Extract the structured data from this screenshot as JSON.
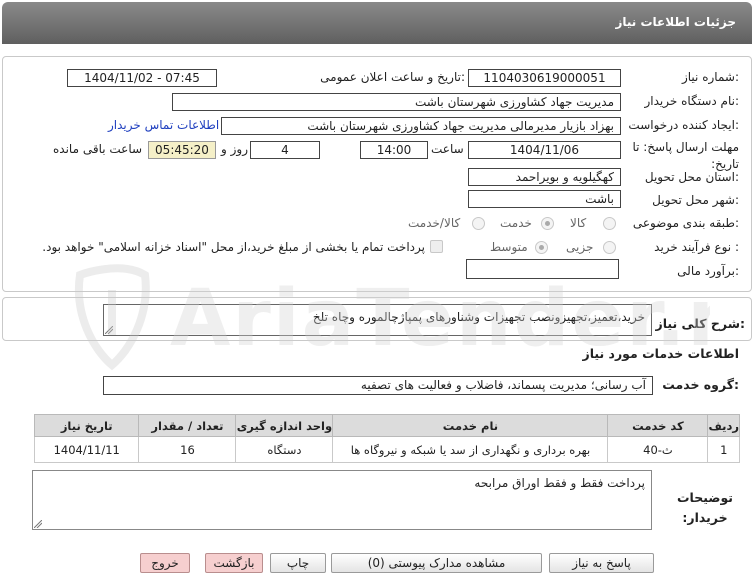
{
  "header": {
    "title": "جزئیات اطلاعات نیاز"
  },
  "form": {
    "need_number_label": "شماره نیاز:",
    "need_number": "1104030619000051",
    "announce_label": "تاریخ و ساعت اعلان عمومی:",
    "announce_value": "1404/11/02 - 07:45",
    "buyer_org_label": "نام دستگاه خریدار:",
    "buyer_org": "مدیریت جهاد کشاورزی شهرستان باشت",
    "creator_label": "ایجاد کننده درخواست:",
    "creator": "بهزاد بازیار مدیرمالی مدیریت جهاد کشاورزی شهرستان باشت",
    "contact_link": "اطلاعات تماس خریدار",
    "deadline_label": "مهلت ارسال پاسخ: تا تاریخ:",
    "deadline_date": "1404/11/06",
    "time_label": "ساعت",
    "deadline_time": "14:00",
    "days_value": "4",
    "days_label": "روز و",
    "remaining_time": "05:45:20",
    "remaining_label": "ساعت باقی مانده",
    "province_label": "استان محل تحویل:",
    "province": "کهگیلویه و بویراحمد",
    "city_label": "شهر محل تحویل:",
    "city": "باشت",
    "category_label": "طبقه بندی موضوعی:",
    "category_options": [
      "کالا",
      "خدمت",
      "کالا/خدمت"
    ],
    "process_label": "نوع فرآیند خرید :",
    "process_options": [
      "جزیی",
      "متوسط"
    ],
    "payment_note": "پرداخت تمام یا بخشی از مبلغ خرید،از محل \"اسناد خزانه اسلامی\" خواهد بود.",
    "budget_label": "برآورد مالی:",
    "budget_value": ""
  },
  "summary": {
    "label": "شرح کلی نیاز:",
    "text": "خرید،تعمیز،تجهیزونصب تجهیزات وشناورهای پمپاژچالموره وچاه تلخ"
  },
  "services": {
    "section_title": "اطلاعات خدمات مورد نیاز",
    "group_label": "گروه خدمت:",
    "group_value": "آب رسانی؛ مدیریت پسماند، فاضلاب و فعالیت های تصفیه",
    "table": {
      "headers": [
        "ردیف",
        "کد خدمت",
        "نام خدمت",
        "واحد اندازه گیری",
        "تعداد / مقدار",
        "تاریخ نیاز"
      ],
      "rows": [
        [
          "1",
          "ث-40",
          "بهره برداری و نگهداری از سد یا شبکه و نیروگاه ها",
          "دستگاه",
          "16",
          "1404/11/11"
        ]
      ]
    }
  },
  "buyer_notes": {
    "label": "توضیحات خریدار:",
    "text": "پرداخت فقط و فقط اوراق مرابحه"
  },
  "buttons": {
    "reply": "پاسخ به نیاز",
    "docs": "مشاهده مدارک پیوستی (0)",
    "print": "چاپ",
    "back": "بازگشت",
    "exit": "خروج"
  },
  "watermark": {
    "text": "AriaTender.neT"
  },
  "colors": {
    "header": "#6e6e6e",
    "timer_bg": "#f5f0c8",
    "link": "#1f3fbf",
    "pink_button": "#f6cfcf"
  }
}
